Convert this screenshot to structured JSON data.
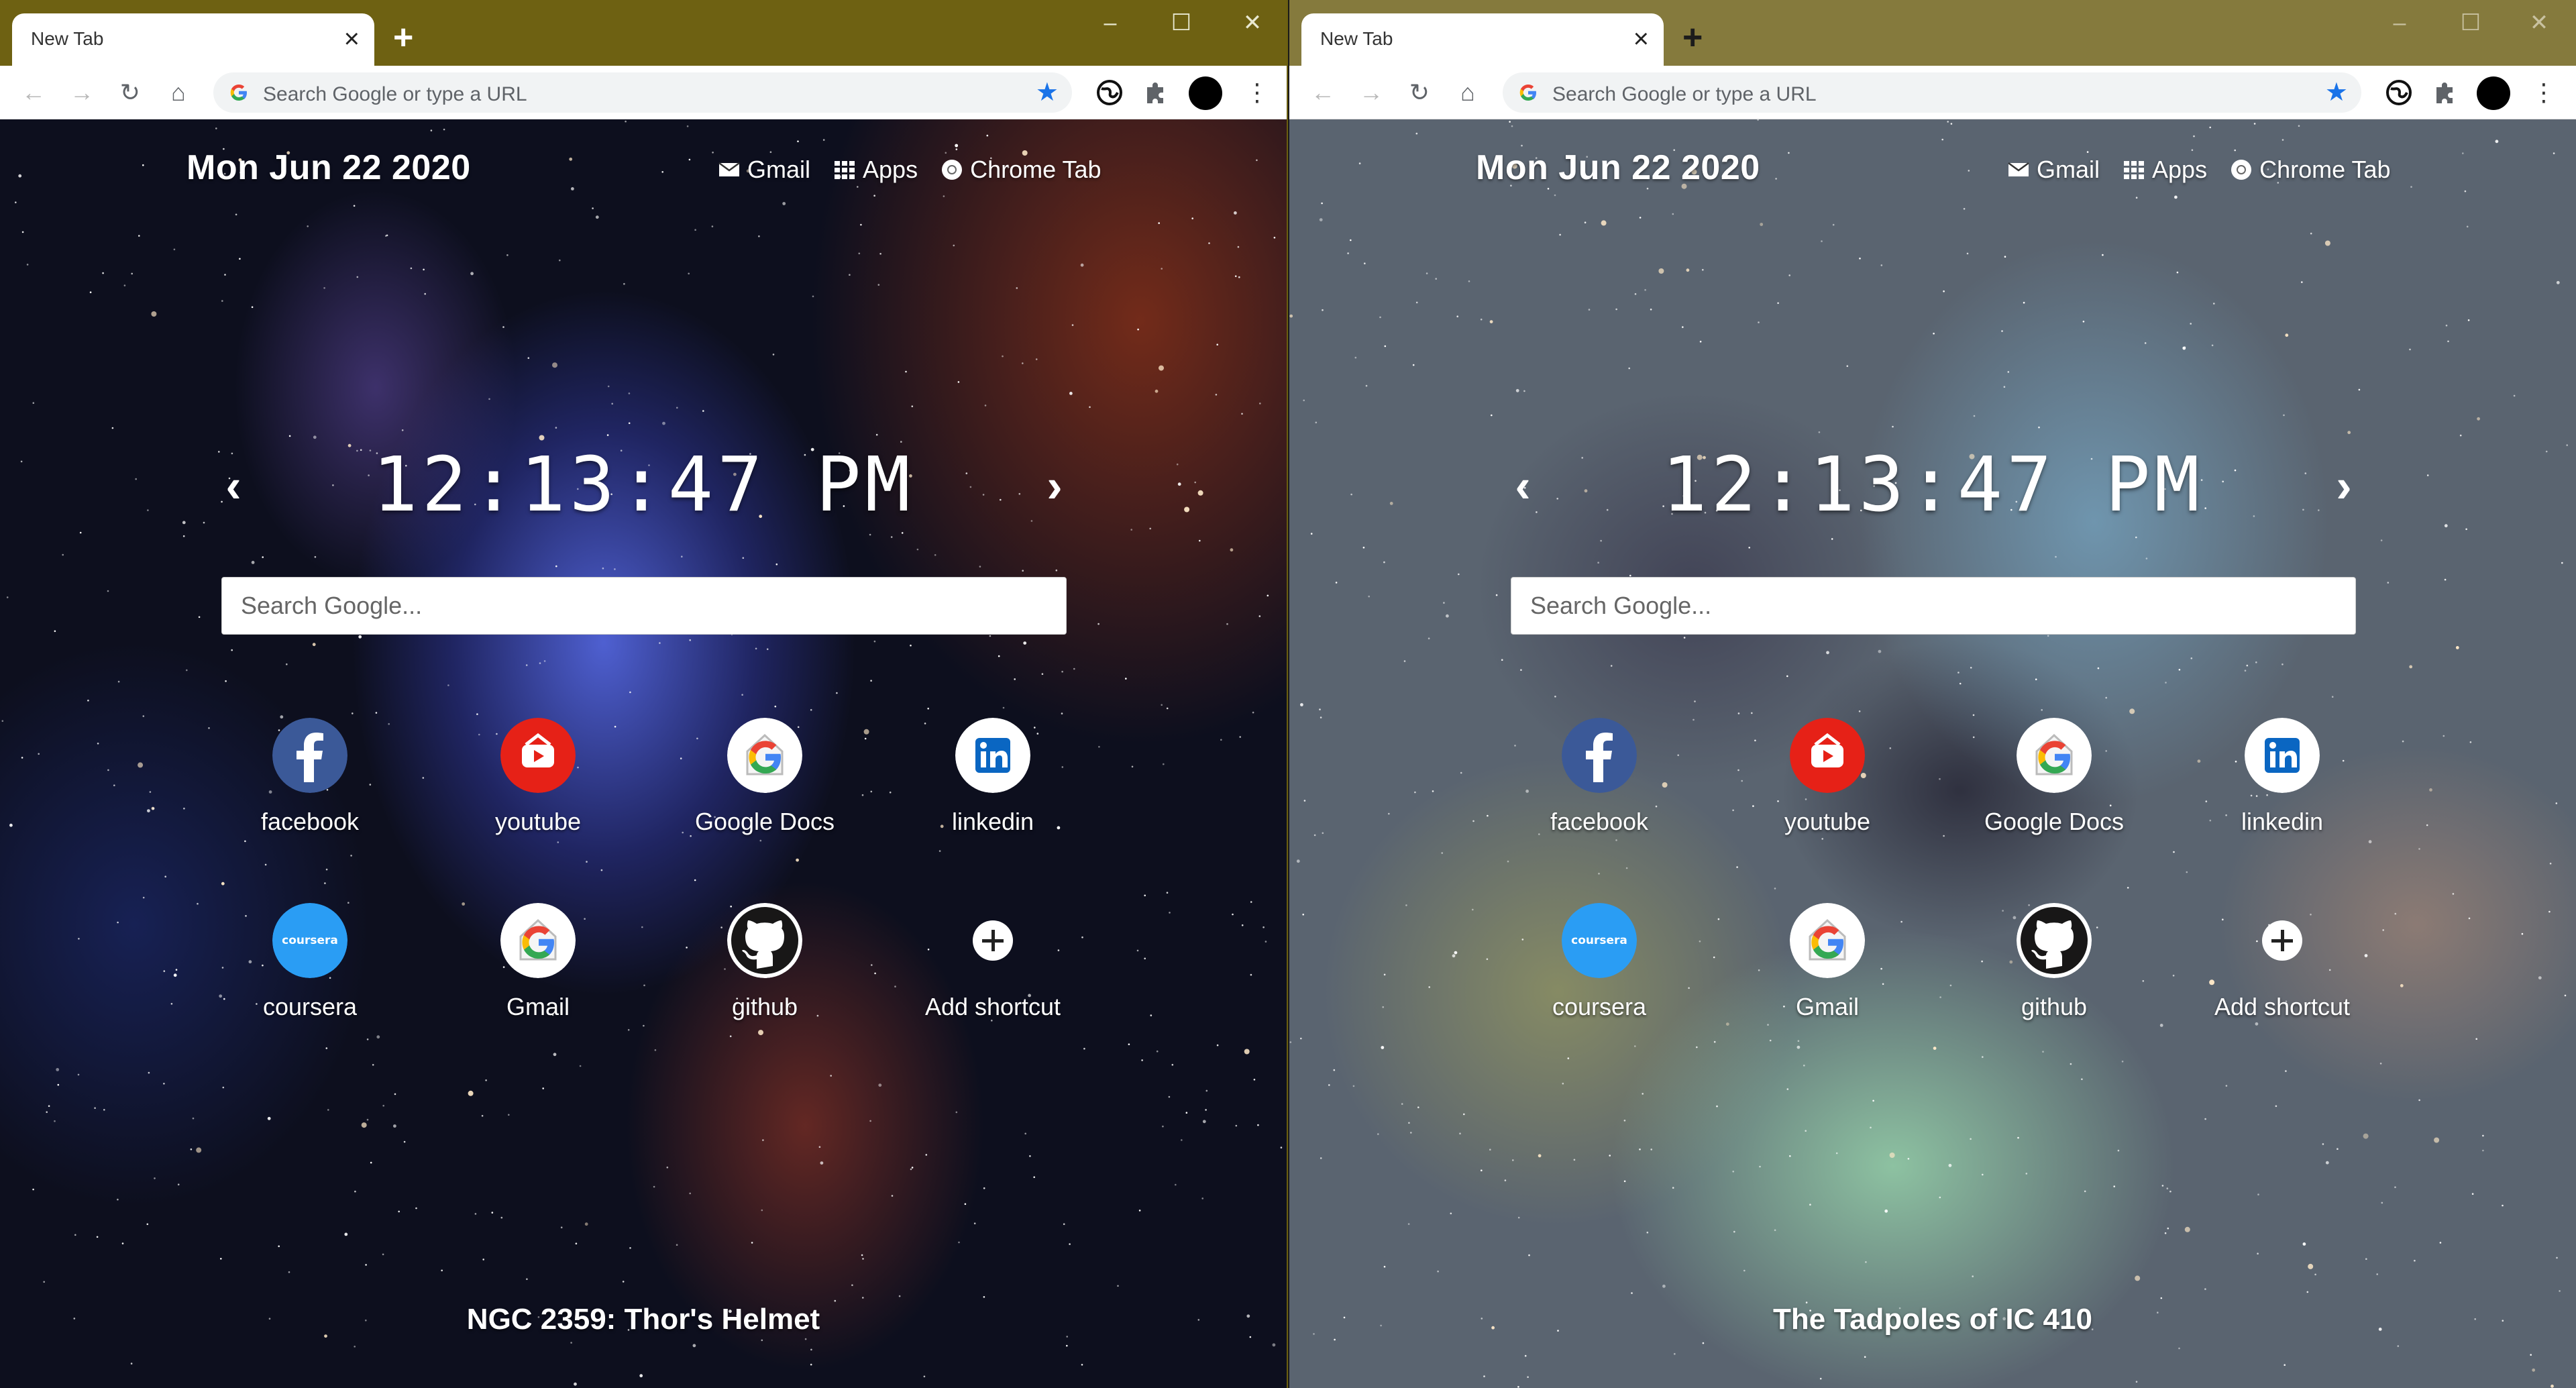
{
  "windows": [
    {
      "tab_title": "New Tab",
      "omnibox_placeholder": "Search Google or type a URL",
      "date": "Mon Jun 22 2020",
      "links": {
        "gmail": "Gmail",
        "apps": "Apps",
        "chrome_tab": "Chrome Tab"
      },
      "time": "12:13:47 PM",
      "search_placeholder": "Search Google...",
      "shortcuts": [
        {
          "label": "facebook",
          "icon": "facebook-icon"
        },
        {
          "label": "youtube",
          "icon": "youtube-icon"
        },
        {
          "label": "Google Docs",
          "icon": "google-icon"
        },
        {
          "label": "linkedin",
          "icon": "linkedin-icon"
        },
        {
          "label": "coursera",
          "icon": "coursera-icon"
        },
        {
          "label": "Gmail",
          "icon": "google-icon"
        },
        {
          "label": "github",
          "icon": "github-icon"
        },
        {
          "label": "Add shortcut",
          "icon": "plus-icon"
        }
      ],
      "caption": "NGC 2359: Thor's Helmet"
    },
    {
      "tab_title": "New Tab",
      "omnibox_placeholder": "Search Google or type a URL",
      "date": "Mon Jun 22 2020",
      "links": {
        "gmail": "Gmail",
        "apps": "Apps",
        "chrome_tab": "Chrome Tab"
      },
      "time": "12:13:47 PM",
      "search_placeholder": "Search Google...",
      "shortcuts": [
        {
          "label": "facebook",
          "icon": "facebook-icon"
        },
        {
          "label": "youtube",
          "icon": "youtube-icon"
        },
        {
          "label": "Google Docs",
          "icon": "google-icon"
        },
        {
          "label": "linkedin",
          "icon": "linkedin-icon"
        },
        {
          "label": "coursera",
          "icon": "coursera-icon"
        },
        {
          "label": "Gmail",
          "icon": "google-icon"
        },
        {
          "label": "github",
          "icon": "github-icon"
        },
        {
          "label": "Add shortcut",
          "icon": "plus-icon"
        }
      ],
      "caption": "The Tadpoles of IC 410"
    }
  ],
  "colors": {
    "left_titlebar": "#6e6112",
    "right_titlebar": "#857a3d",
    "bookmark_star": "#1a73e8",
    "facebook": "#3b5998",
    "youtube": "#e62117",
    "linkedin": "#0a66c2",
    "coursera": "#2a9df4",
    "github": "#181717"
  }
}
